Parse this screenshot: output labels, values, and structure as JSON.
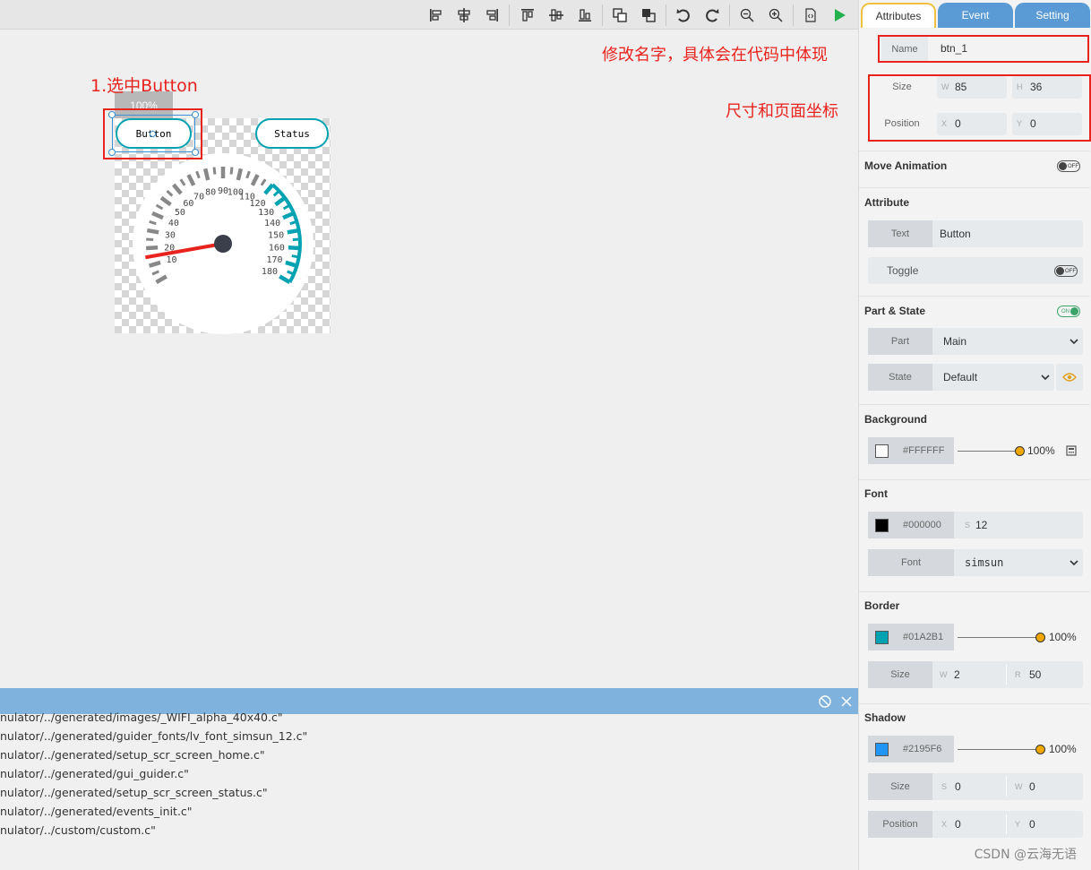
{
  "toolbar": {
    "icons": [
      "align-left-icon",
      "align-center-icon",
      "align-right-icon",
      "align-top-icon",
      "align-middle-icon",
      "align-bottom-icon",
      "bring-forward-icon",
      "send-backward-icon",
      "undo-icon",
      "redo-icon",
      "zoom-out-icon",
      "zoom-in-icon",
      "code-icon",
      "run-icon"
    ],
    "run_color": "#22b14c"
  },
  "canvas": {
    "zoom_label": "100%",
    "button_text": "Button",
    "status_text": "Status",
    "annotation_select": "1.选中Button",
    "annotation_name": "修改名字，具体会在代码中体现",
    "annotation_size": "尺寸和页面坐标",
    "gauge_labels": [
      "10",
      "20",
      "30",
      "40",
      "50",
      "60",
      "70",
      "80",
      "90",
      "100",
      "110",
      "120",
      "130",
      "140",
      "150",
      "160",
      "170",
      "180"
    ],
    "gauge_needle_value": 15,
    "accent_color": "#01A2B1",
    "needle_color": "#e8231e"
  },
  "console": {
    "lines": [
      "nulator/../generated/images/_WIFI_alpha_40x40.c\"",
      "nulator/../generated/guider_fonts/lv_font_simsun_12.c\"",
      "nulator/../generated/setup_scr_screen_home.c\"",
      "nulator/../generated/gui_guider.c\"",
      "nulator/../generated/setup_scr_screen_status.c\"",
      "nulator/../generated/events_init.c\"",
      "nulator/../custom/custom.c\""
    ]
  },
  "panel": {
    "tabs": [
      "Attributes",
      "Event",
      "Setting"
    ],
    "name_label": "Name",
    "name_value": "btn_1",
    "size_label": "Size",
    "w_label": "W",
    "w_value": "85",
    "h_label": "H",
    "h_value": "36",
    "position_label": "Position",
    "x_label": "X",
    "x_value": "0",
    "y_label": "Y",
    "y_value": "0",
    "move_animation": "Move Animation",
    "toggle_off": "OFF",
    "toggle_on": "ON",
    "attribute_title": "Attribute",
    "text_label": "Text",
    "text_value": "Button",
    "toggle_label": "Toggle",
    "part_state_title": "Part & State",
    "part_label": "Part",
    "part_value": "Main",
    "state_label": "State",
    "state_value": "Default",
    "background_title": "Background",
    "bg_color": "#FFFFFF",
    "bg_opacity": "100%",
    "font_title": "Font",
    "font_color": "#000000",
    "font_size_label": "S",
    "font_size": "12",
    "font_label": "Font",
    "font_value": "simsun",
    "border_title": "Border",
    "border_color": "#01A2B1",
    "border_opacity": "100%",
    "border_size_label": "Size",
    "border_w_label": "W",
    "border_w": "2",
    "border_r_label": "R",
    "border_r": "50",
    "shadow_title": "Shadow",
    "shadow_color": "#2195F6",
    "shadow_opacity": "100%",
    "shadow_size_label": "Size",
    "shadow_s_label": "S",
    "shadow_s": "0",
    "shadow_w_label": "W",
    "shadow_w": "0",
    "shadow_pos_label": "Position",
    "shadow_x_label": "X",
    "shadow_x": "0",
    "shadow_y_label": "Y",
    "shadow_y": "0",
    "watermark": "CSDN @云海无语"
  }
}
